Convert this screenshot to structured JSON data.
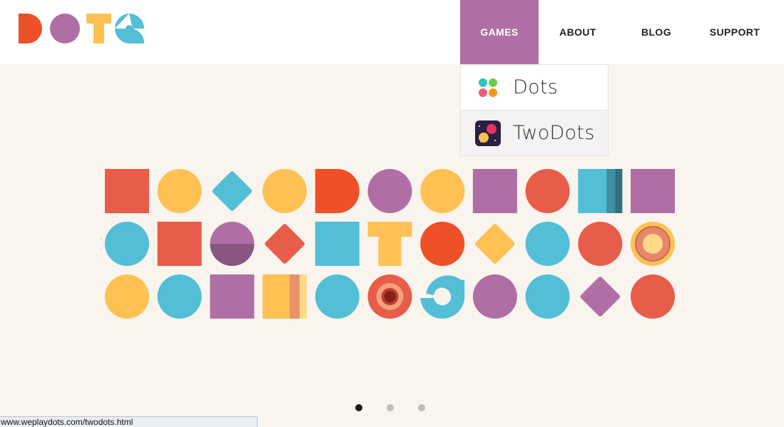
{
  "header": {
    "logo_text": "DOTS",
    "nav": [
      {
        "label": "GAMES",
        "active": true
      },
      {
        "label": "ABOUT"
      },
      {
        "label": "BLOG"
      },
      {
        "label": "SUPPORT"
      }
    ]
  },
  "games_menu": {
    "items": [
      {
        "label": "Dots",
        "icon": "dots-app-icon"
      },
      {
        "label": "TwoDots",
        "icon": "twodots-app-icon"
      }
    ]
  },
  "colors": {
    "red": "#e85d49",
    "yellow": "#ffc153",
    "blue": "#53bfd6",
    "purple": "#b06fa4",
    "orange": "#ee5028",
    "nav_active_bg": "#b06fa4",
    "background": "#f9f4ee"
  },
  "hero": {
    "rows": [
      [
        "red-square",
        "yellow-circle",
        "blue-diamond",
        "yellow-circle",
        "orange-d-shape",
        "purple-circle",
        "yellow-circle",
        "purple-square",
        "red-circle",
        "blue-book",
        "purple-square"
      ],
      [
        "blue-circle",
        "red-square",
        "purple-half-circle",
        "red-diamond",
        "blue-square",
        "yellow-t-shape",
        "orange-circle",
        "yellow-diamond",
        "blue-circle",
        "red-circle",
        "yellow-ring"
      ],
      [
        "yellow-circle",
        "blue-circle",
        "purple-square",
        "yellow-book",
        "blue-circle",
        "red-ring",
        "blue-s-shape",
        "purple-circle",
        "blue-circle",
        "purple-diamond",
        "red-circle"
      ]
    ]
  },
  "pager": {
    "count": 3,
    "active_index": 0
  },
  "statusbar": {
    "url": "www.weplaydots.com/twodots.html"
  }
}
